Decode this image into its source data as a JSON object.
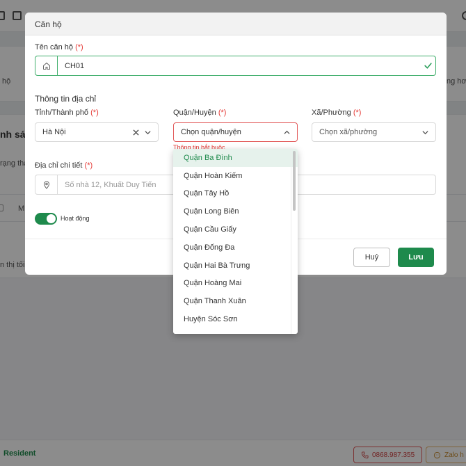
{
  "background": {
    "partial_text_left_1": "hộ",
    "partial_text_right_1": "ng hơ",
    "partial_title": "nh sác",
    "partial_text_left_2": "rạng thá",
    "partial_col": "M",
    "partial_text_left_3": "n thị tối",
    "brand": "Resident",
    "phone_label": "0868.987.355",
    "zalo_label": "Zalo h"
  },
  "modal": {
    "title": "Căn hộ",
    "apartment_name": {
      "label": "Tên căn hộ",
      "required": "(*)",
      "value": "CH01"
    },
    "address_section_title": "Thông tin địa chỉ",
    "province": {
      "label": "Tỉnh/Thành phố",
      "required": "(*)",
      "value": "Hà Nội"
    },
    "district": {
      "label": "Quận/Huyện",
      "required": "(*)",
      "placeholder": "Chọn quận/huyện",
      "error": "Thông tin bắt buộc"
    },
    "ward": {
      "label": "Xã/Phường",
      "required": "(*)",
      "placeholder": "Chọn xã/phường"
    },
    "address_detail": {
      "label": "Địa chỉ chi tiết",
      "required": "(*)",
      "placeholder": "Số nhà 12, Khuất Duy Tiến"
    },
    "active_toggle": {
      "label": "Hoạt động",
      "on": true
    },
    "cancel_label": "Huỷ",
    "save_label": "Lưu"
  },
  "district_dropdown": {
    "items": [
      "Quận Ba Đình",
      "Quận Hoàn Kiếm",
      "Quận Tây Hồ",
      "Quận Long Biên",
      "Quận Cầu Giấy",
      "Quận Đống Đa",
      "Quận Hai Bà Trưng",
      "Quận Hoàng Mai",
      "Quận Thanh Xuân",
      "Huyện Sóc Sơn"
    ],
    "highlighted_index": 0
  },
  "colors": {
    "primary": "#1e8a4c",
    "error": "#e53935"
  },
  "icons": {
    "apartment_addon": "home-icon",
    "address_addon": "location-pin-icon",
    "valid": "check-icon",
    "phone": "phone-icon",
    "zalo": "chat-icon"
  }
}
